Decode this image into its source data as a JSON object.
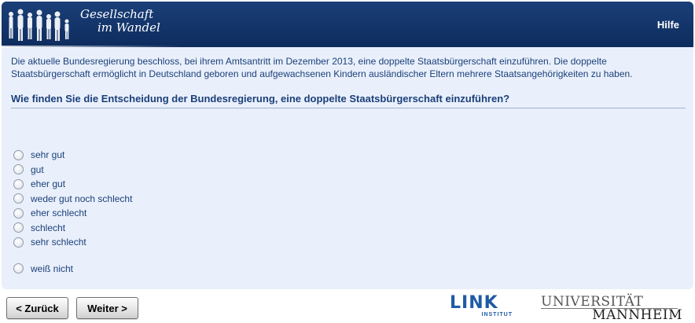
{
  "header": {
    "logo_line1": "Gesellschaft",
    "logo_line2": "im Wandel",
    "help_label": "Hilfe"
  },
  "survey": {
    "intro": "Die aktuelle Bundesregierung beschloss, bei ihrem Amtsantritt im Dezember 2013, eine doppelte Staatsbürgerschaft einzuführen. Die doppelte Staatsbürgerschaft ermöglicht in Deutschland geboren und aufgewachsenen Kindern ausländischer Eltern mehrere Staatsangehörigkeiten zu haben.",
    "question": "Wie finden Sie die Entscheidung der Bundesregierung, eine doppelte Staatsbürgerschaft einzuführen?",
    "options": [
      "sehr gut",
      "gut",
      "eher gut",
      "weder gut noch schlecht",
      "eher schlecht",
      "schlecht",
      "sehr schlecht"
    ],
    "extra_option": "weiß nicht"
  },
  "nav": {
    "back_label": "< Zurück",
    "next_label": "Weiter >"
  },
  "logos": {
    "link_word": "LINK",
    "link_sub": "INSTITUT",
    "uni_top": "UNIVERSITÄT",
    "uni_bottom": "MANNHEIM"
  },
  "colors": {
    "header_bg": "#0e2c5e",
    "panel_bg": "#e9f0fb",
    "text": "#1c3f7a",
    "link_blue": "#1f5aa6"
  }
}
